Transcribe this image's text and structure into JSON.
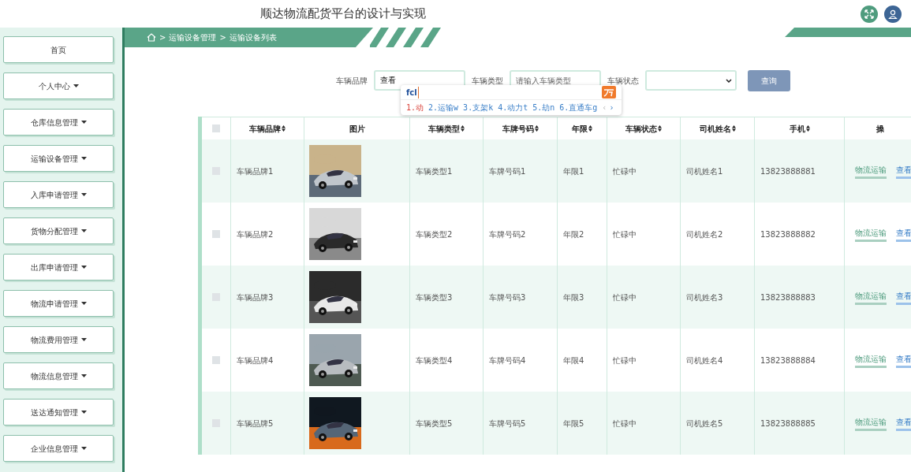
{
  "header": {
    "title": "顺达物流配货平台的设计与实现"
  },
  "breadcrumb": [
    ">",
    "运输设备管理",
    ">",
    "运输设备列表"
  ],
  "sidebar": {
    "items": [
      {
        "label": "首页",
        "dropdown": false
      },
      {
        "label": "个人中心",
        "dropdown": true
      },
      {
        "label": "仓库信息管理",
        "dropdown": true
      },
      {
        "label": "运输设备管理",
        "dropdown": true
      },
      {
        "label": "入库申请管理",
        "dropdown": true
      },
      {
        "label": "货物分配管理",
        "dropdown": true
      },
      {
        "label": "出库申请管理",
        "dropdown": true
      },
      {
        "label": "物流申请管理",
        "dropdown": true
      },
      {
        "label": "物流费用管理",
        "dropdown": true
      },
      {
        "label": "物流信息管理",
        "dropdown": true
      },
      {
        "label": "送达通知管理",
        "dropdown": true
      },
      {
        "label": "企业信息管理",
        "dropdown": true
      }
    ]
  },
  "search": {
    "fields": [
      {
        "label": "车辆品牌",
        "kind": "text",
        "value": "查看"
      },
      {
        "label": "车辆类型",
        "kind": "text",
        "placeholder": "请输入车辆类型"
      },
      {
        "label": "车辆状态",
        "kind": "select"
      }
    ],
    "button": "查询"
  },
  "ime_popup": {
    "composition": "fcl",
    "candidates": [
      {
        "label": "1.动",
        "selected": true
      },
      {
        "label": "2.运输w",
        "selected": false
      },
      {
        "label": "3.支架k",
        "selected": false
      },
      {
        "label": "4.动力t",
        "selected": false
      },
      {
        "label": "5.劫n",
        "selected": false
      },
      {
        "label": "6.直通车g",
        "selected": false
      }
    ],
    "prev": "‹",
    "next": "›"
  },
  "table": {
    "select_all_checked": false,
    "columns": [
      {
        "label": "车辆品牌",
        "sortable": true
      },
      {
        "label": "图片",
        "sortable": false
      },
      {
        "label": "车辆类型",
        "sortable": true
      },
      {
        "label": "车牌号码",
        "sortable": true
      },
      {
        "label": "年限",
        "sortable": true
      },
      {
        "label": "车辆状态",
        "sortable": true
      },
      {
        "label": "司机姓名",
        "sortable": true
      },
      {
        "label": "手机",
        "sortable": true
      },
      {
        "label": "操",
        "sortable": false
      }
    ],
    "rows": [
      {
        "checked": false,
        "cells": [
          "车辆品牌1",
          "",
          "车辆类型1",
          "车牌号码1",
          "年限1",
          "忙碌中",
          "司机姓名1",
          "13823888881"
        ],
        "actions": [
          "物流运输",
          "查看"
        ]
      },
      {
        "checked": false,
        "cells": [
          "车辆品牌2",
          "",
          "车辆类型2",
          "车牌号码2",
          "年限2",
          "忙碌中",
          "司机姓名2",
          "13823888882"
        ],
        "actions": [
          "物流运输",
          "查看"
        ]
      },
      {
        "checked": false,
        "cells": [
          "车辆品牌3",
          "",
          "车辆类型3",
          "车牌号码3",
          "年限3",
          "忙碌中",
          "司机姓名3",
          "13823888883"
        ],
        "actions": [
          "物流运输",
          "查看"
        ]
      },
      {
        "checked": false,
        "cells": [
          "车辆品牌4",
          "",
          "车辆类型4",
          "车牌号码4",
          "年限4",
          "忙碌中",
          "司机姓名4",
          "13823888884"
        ],
        "actions": [
          "物流运输",
          "查看"
        ]
      },
      {
        "checked": false,
        "cells": [
          "车辆品牌5",
          "",
          "车辆类型5",
          "车牌号码5",
          "年限5",
          "忙碌中",
          "司机姓名5",
          "13823888885"
        ],
        "actions": [
          "物流运输",
          "查看"
        ]
      }
    ]
  }
}
